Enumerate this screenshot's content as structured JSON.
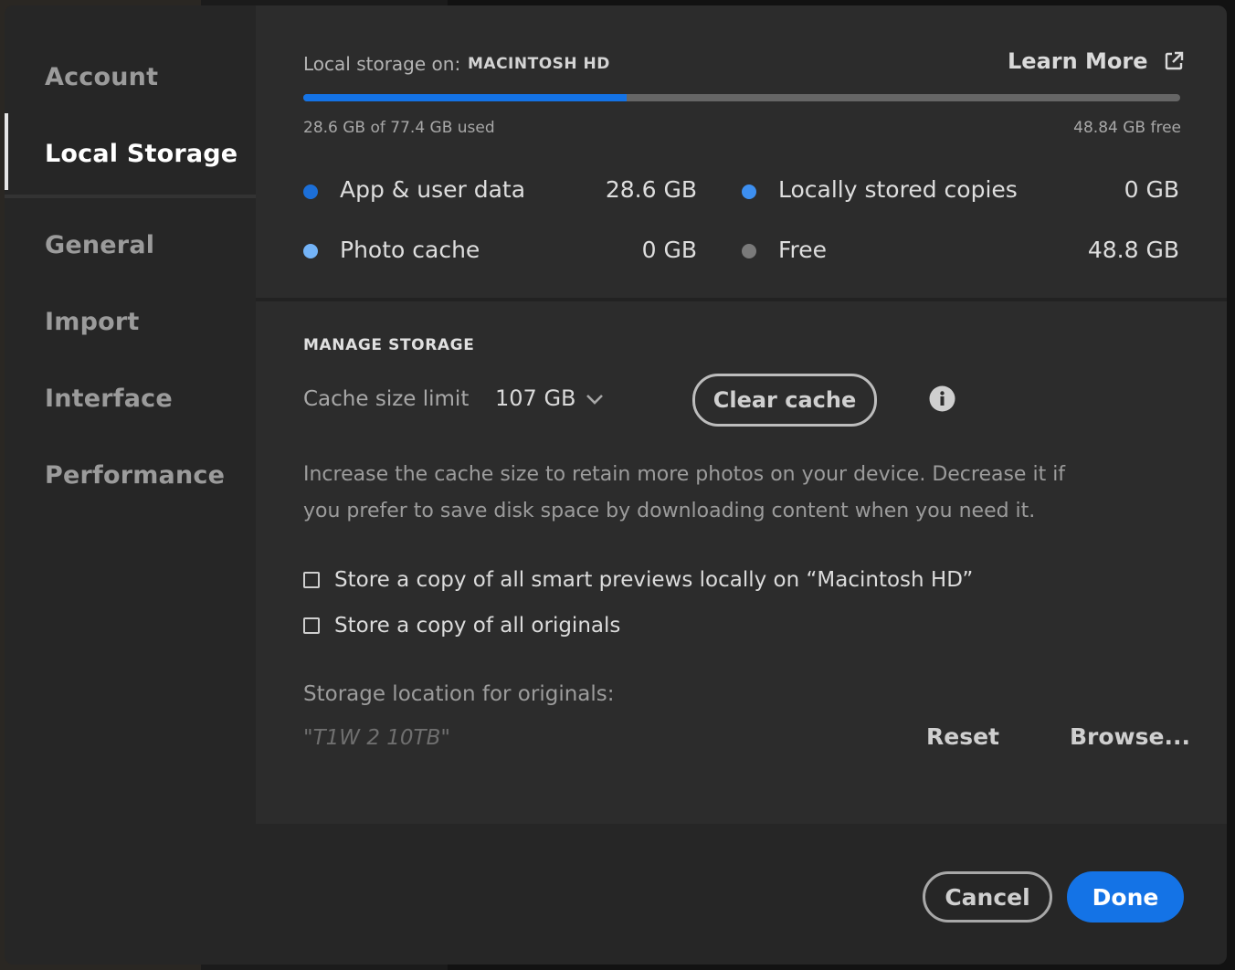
{
  "sidebar": {
    "items": [
      {
        "label": "Account"
      },
      {
        "label": "Local Storage"
      },
      {
        "label": "General"
      },
      {
        "label": "Import"
      },
      {
        "label": "Interface"
      },
      {
        "label": "Performance"
      }
    ],
    "active_index": 1
  },
  "storage": {
    "on_label": "Local storage on:",
    "drive_name": "MACINTOSH HD",
    "learn_more": "Learn More",
    "learn_more_icon": "external-link-icon",
    "used_text": "28.6 GB of 77.4 GB used",
    "free_text": "48.84 GB free",
    "used_fraction": 0.369,
    "legend": [
      {
        "label": "App & user data",
        "value": "28.6 GB",
        "color": "#1c6fd8"
      },
      {
        "label": "Locally stored copies",
        "value": "0 GB",
        "color": "#3d8ff0"
      },
      {
        "label": "Photo cache",
        "value": "0 GB",
        "color": "#74b4f8"
      },
      {
        "label": "Free",
        "value": "48.8 GB",
        "color": "#7a7a7a"
      }
    ]
  },
  "manage": {
    "heading": "MANAGE STORAGE",
    "cache_label": "Cache size limit",
    "cache_value": "107 GB",
    "clear_cache": "Clear cache",
    "info_icon": "info-icon",
    "description": "Increase the cache size to retain more photos on your device. Decrease it if you prefer to save disk space by downloading content when you need it.",
    "checkbox_smart_previews": "Store a copy of all smart previews locally on “Macintosh HD”",
    "checkbox_originals": "Store a copy of all originals",
    "smart_previews_checked": false,
    "originals_checked": false,
    "location_label": "Storage location for originals:",
    "location_value": "\"T1W 2 10TB\"",
    "reset": "Reset",
    "browse": "Browse..."
  },
  "footer": {
    "cancel": "Cancel",
    "done": "Done"
  },
  "colors": {
    "accent": "#1473e6",
    "panel": "#2c2c2c",
    "dialog": "#262626"
  }
}
